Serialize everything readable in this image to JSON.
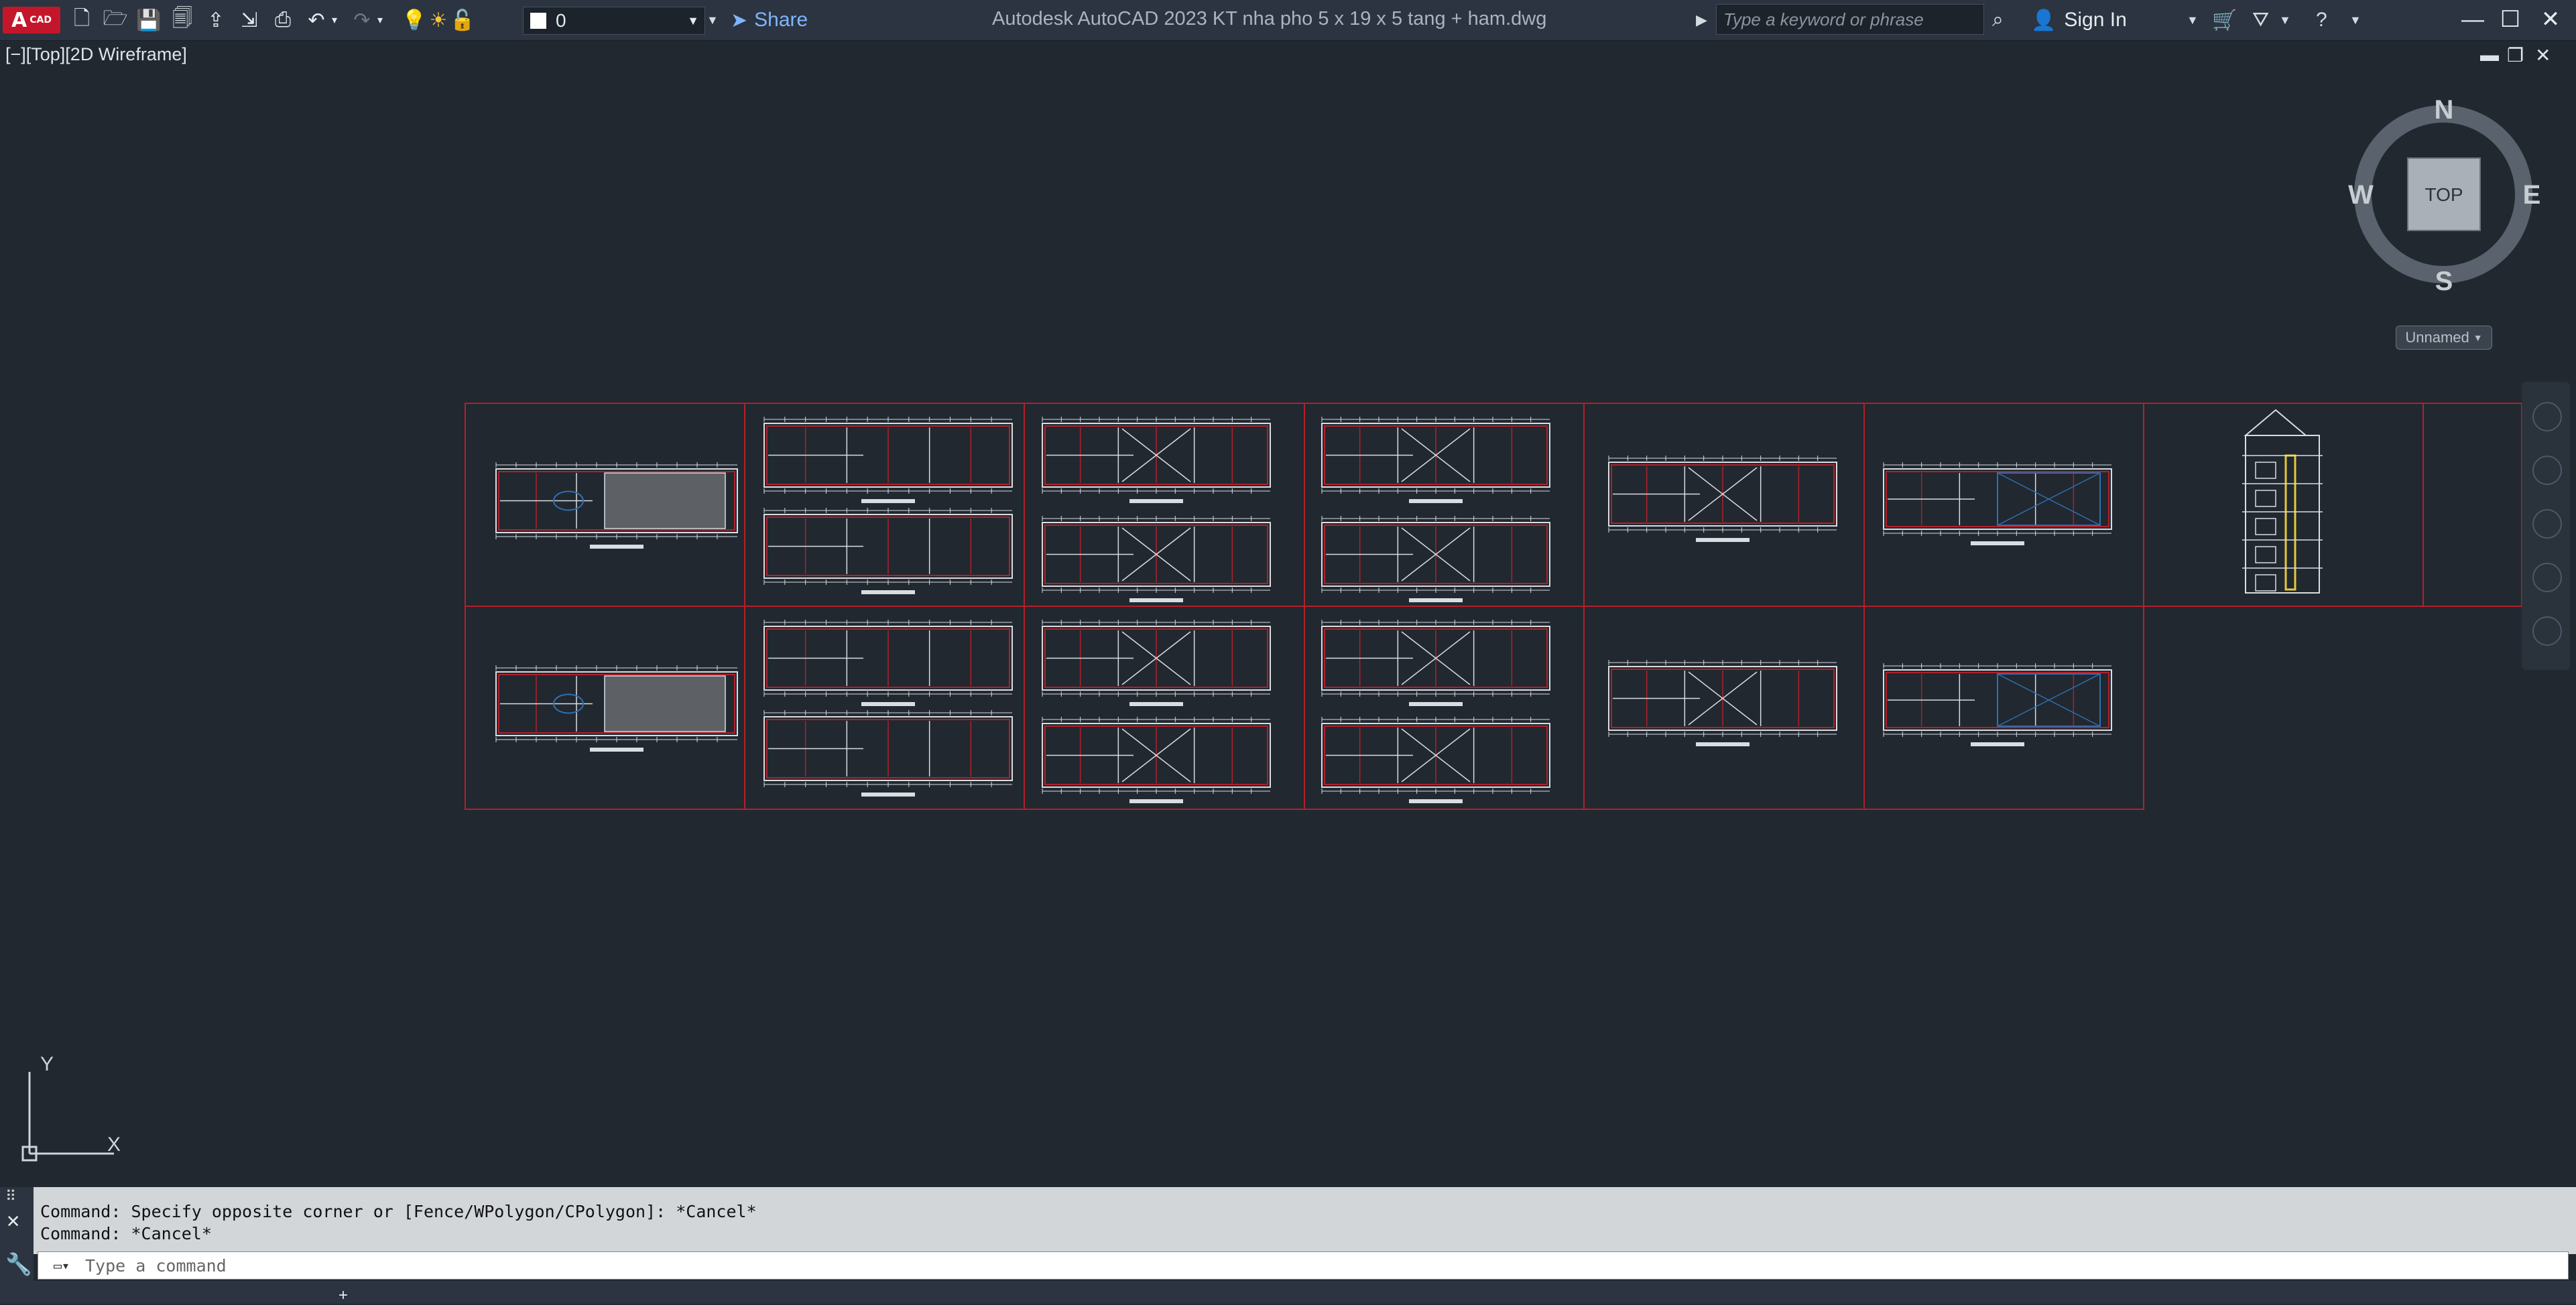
{
  "app": {
    "logo": "A",
    "logo_sub": "CAD",
    "title": "Autodesk AutoCAD 2023    KT nha pho 5 x 19 x 5 tang + ham.dwg"
  },
  "toolbar": {
    "layer_value": "0",
    "share_label": "Share",
    "search_placeholder": "Type a keyword or phrase",
    "signin_label": "Sign In"
  },
  "viewport": {
    "label": "[−][Top][2D Wireframe]"
  },
  "viewcube": {
    "north": "N",
    "south": "S",
    "east": "E",
    "west": "W",
    "face": "TOP",
    "ucs_name": "Unnamed"
  },
  "ucs": {
    "x": "X",
    "y": "Y"
  },
  "command": {
    "history": [
      "Command: Specify opposite corner or [Fence/WPolygon/CPolygon]: *Cancel*",
      "Command: *Cancel*"
    ],
    "placeholder": "Type a command"
  },
  "colors": {
    "background": "#212830",
    "frame_red": "#b3202a",
    "linework": "#d8dde2",
    "accent_blue": "#2f6fb0"
  }
}
